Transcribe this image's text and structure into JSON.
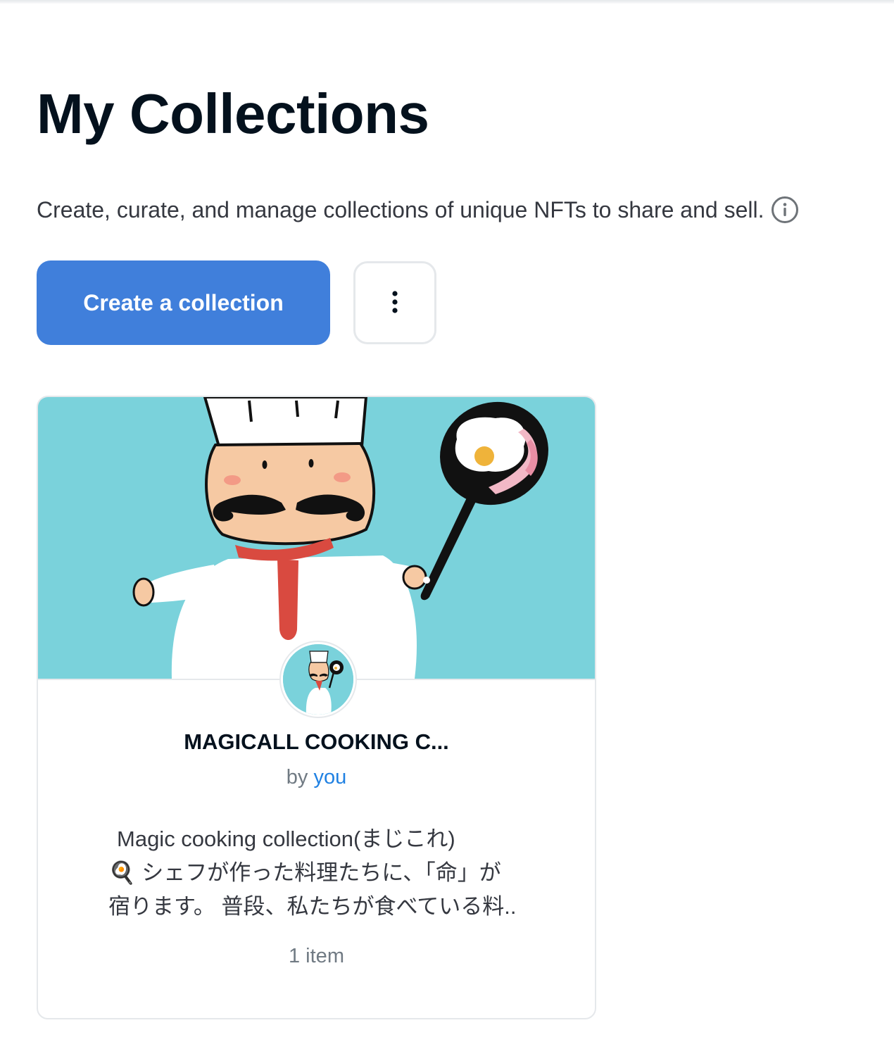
{
  "page": {
    "title": "My Collections",
    "subtitle": "Create, curate, and manage collections of unique NFTs to share and sell."
  },
  "actions": {
    "create_label": "Create a collection",
    "more_icon": "vertical-ellipsis-icon",
    "info_icon": "info-circle-icon"
  },
  "colors": {
    "primary": "#407fdb",
    "banner_bg": "#7ad2db",
    "link": "#2081e2",
    "muted_text": "#707a83"
  },
  "collections": [
    {
      "name": "MAGICALL COOKING C...",
      "by_prefix": "by",
      "owner": "you",
      "description_lines": [
        "Magic cooking collection(まじこれ)",
        "🍳 シェフが作った料理たちに、「命」が",
        "宿ります。 普段、私たちが食べている料.."
      ],
      "item_count": "1 item"
    }
  ]
}
